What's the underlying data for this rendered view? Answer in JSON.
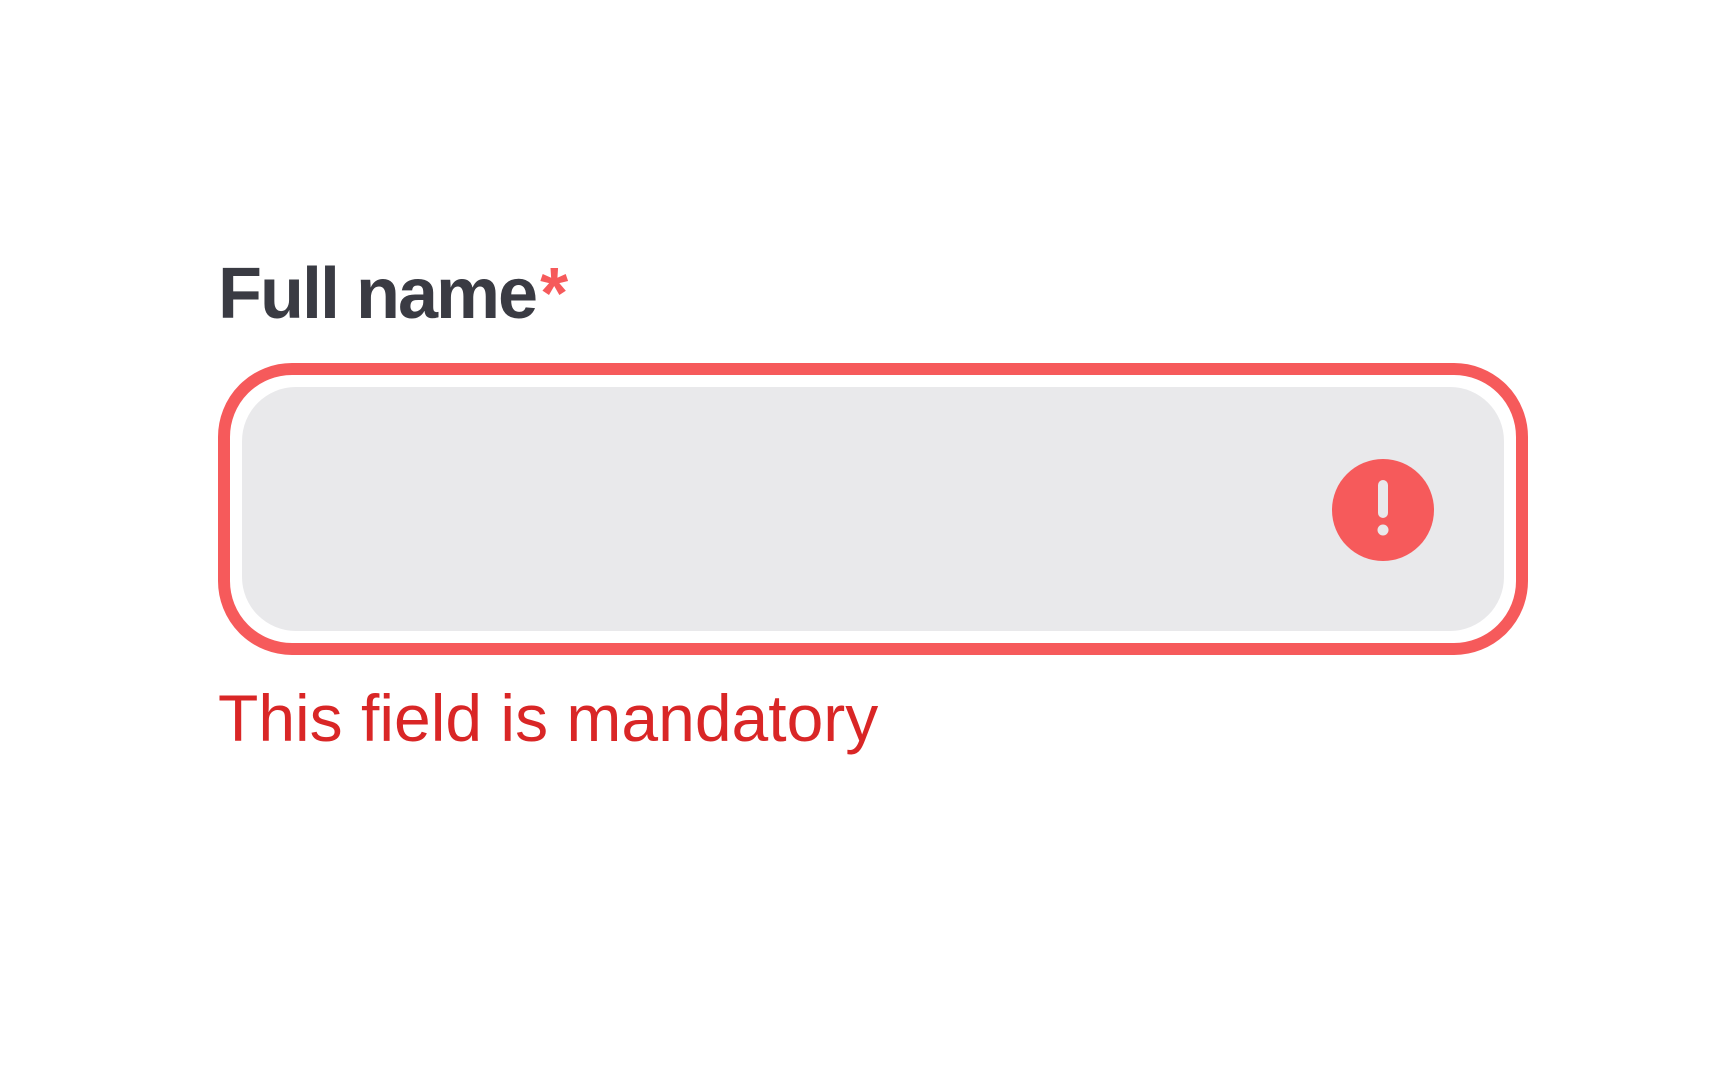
{
  "field": {
    "label": "Full name",
    "required_mark": "*",
    "value": "",
    "placeholder": "",
    "error_message": "This field is mandatory",
    "state": "error"
  },
  "icons": {
    "error": "exclamation-circle-icon"
  },
  "colors": {
    "label": "#3a3b43",
    "required": "#f65a5b",
    "border_error": "#f65a5b",
    "input_background": "#e9e9eb",
    "error_text": "#d92626"
  }
}
